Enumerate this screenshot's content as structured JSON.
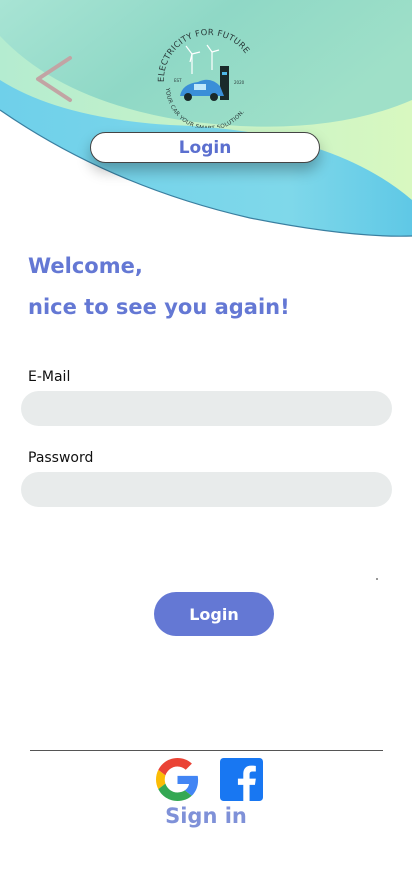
{
  "header": {
    "back_icon": "chevron-left-icon",
    "logo": {
      "top_text": "ELECTRICITY FOR FUTURE",
      "bottom_text": "YOUR CAR YOUR SMART SOLUTION.",
      "est": "EST",
      "year": "2020"
    },
    "title_pill": "Login"
  },
  "welcome": {
    "line1": "Welcome,",
    "line2": "nice to see you again!"
  },
  "form": {
    "email_label": "E-Mail",
    "email_value": "",
    "password_label": "Password",
    "password_value": "",
    "login_button": "Login"
  },
  "social": {
    "icons": [
      "google-icon",
      "facebook-icon"
    ],
    "signin_label": "Sign in"
  },
  "colors": {
    "accent": "#6478d4",
    "signin": "#7f91d8",
    "field_bg": "#e8ebeb",
    "header_teal": "#8fd8c8",
    "header_blue": "#6fd0ea",
    "header_green": "#c4f4c4"
  }
}
